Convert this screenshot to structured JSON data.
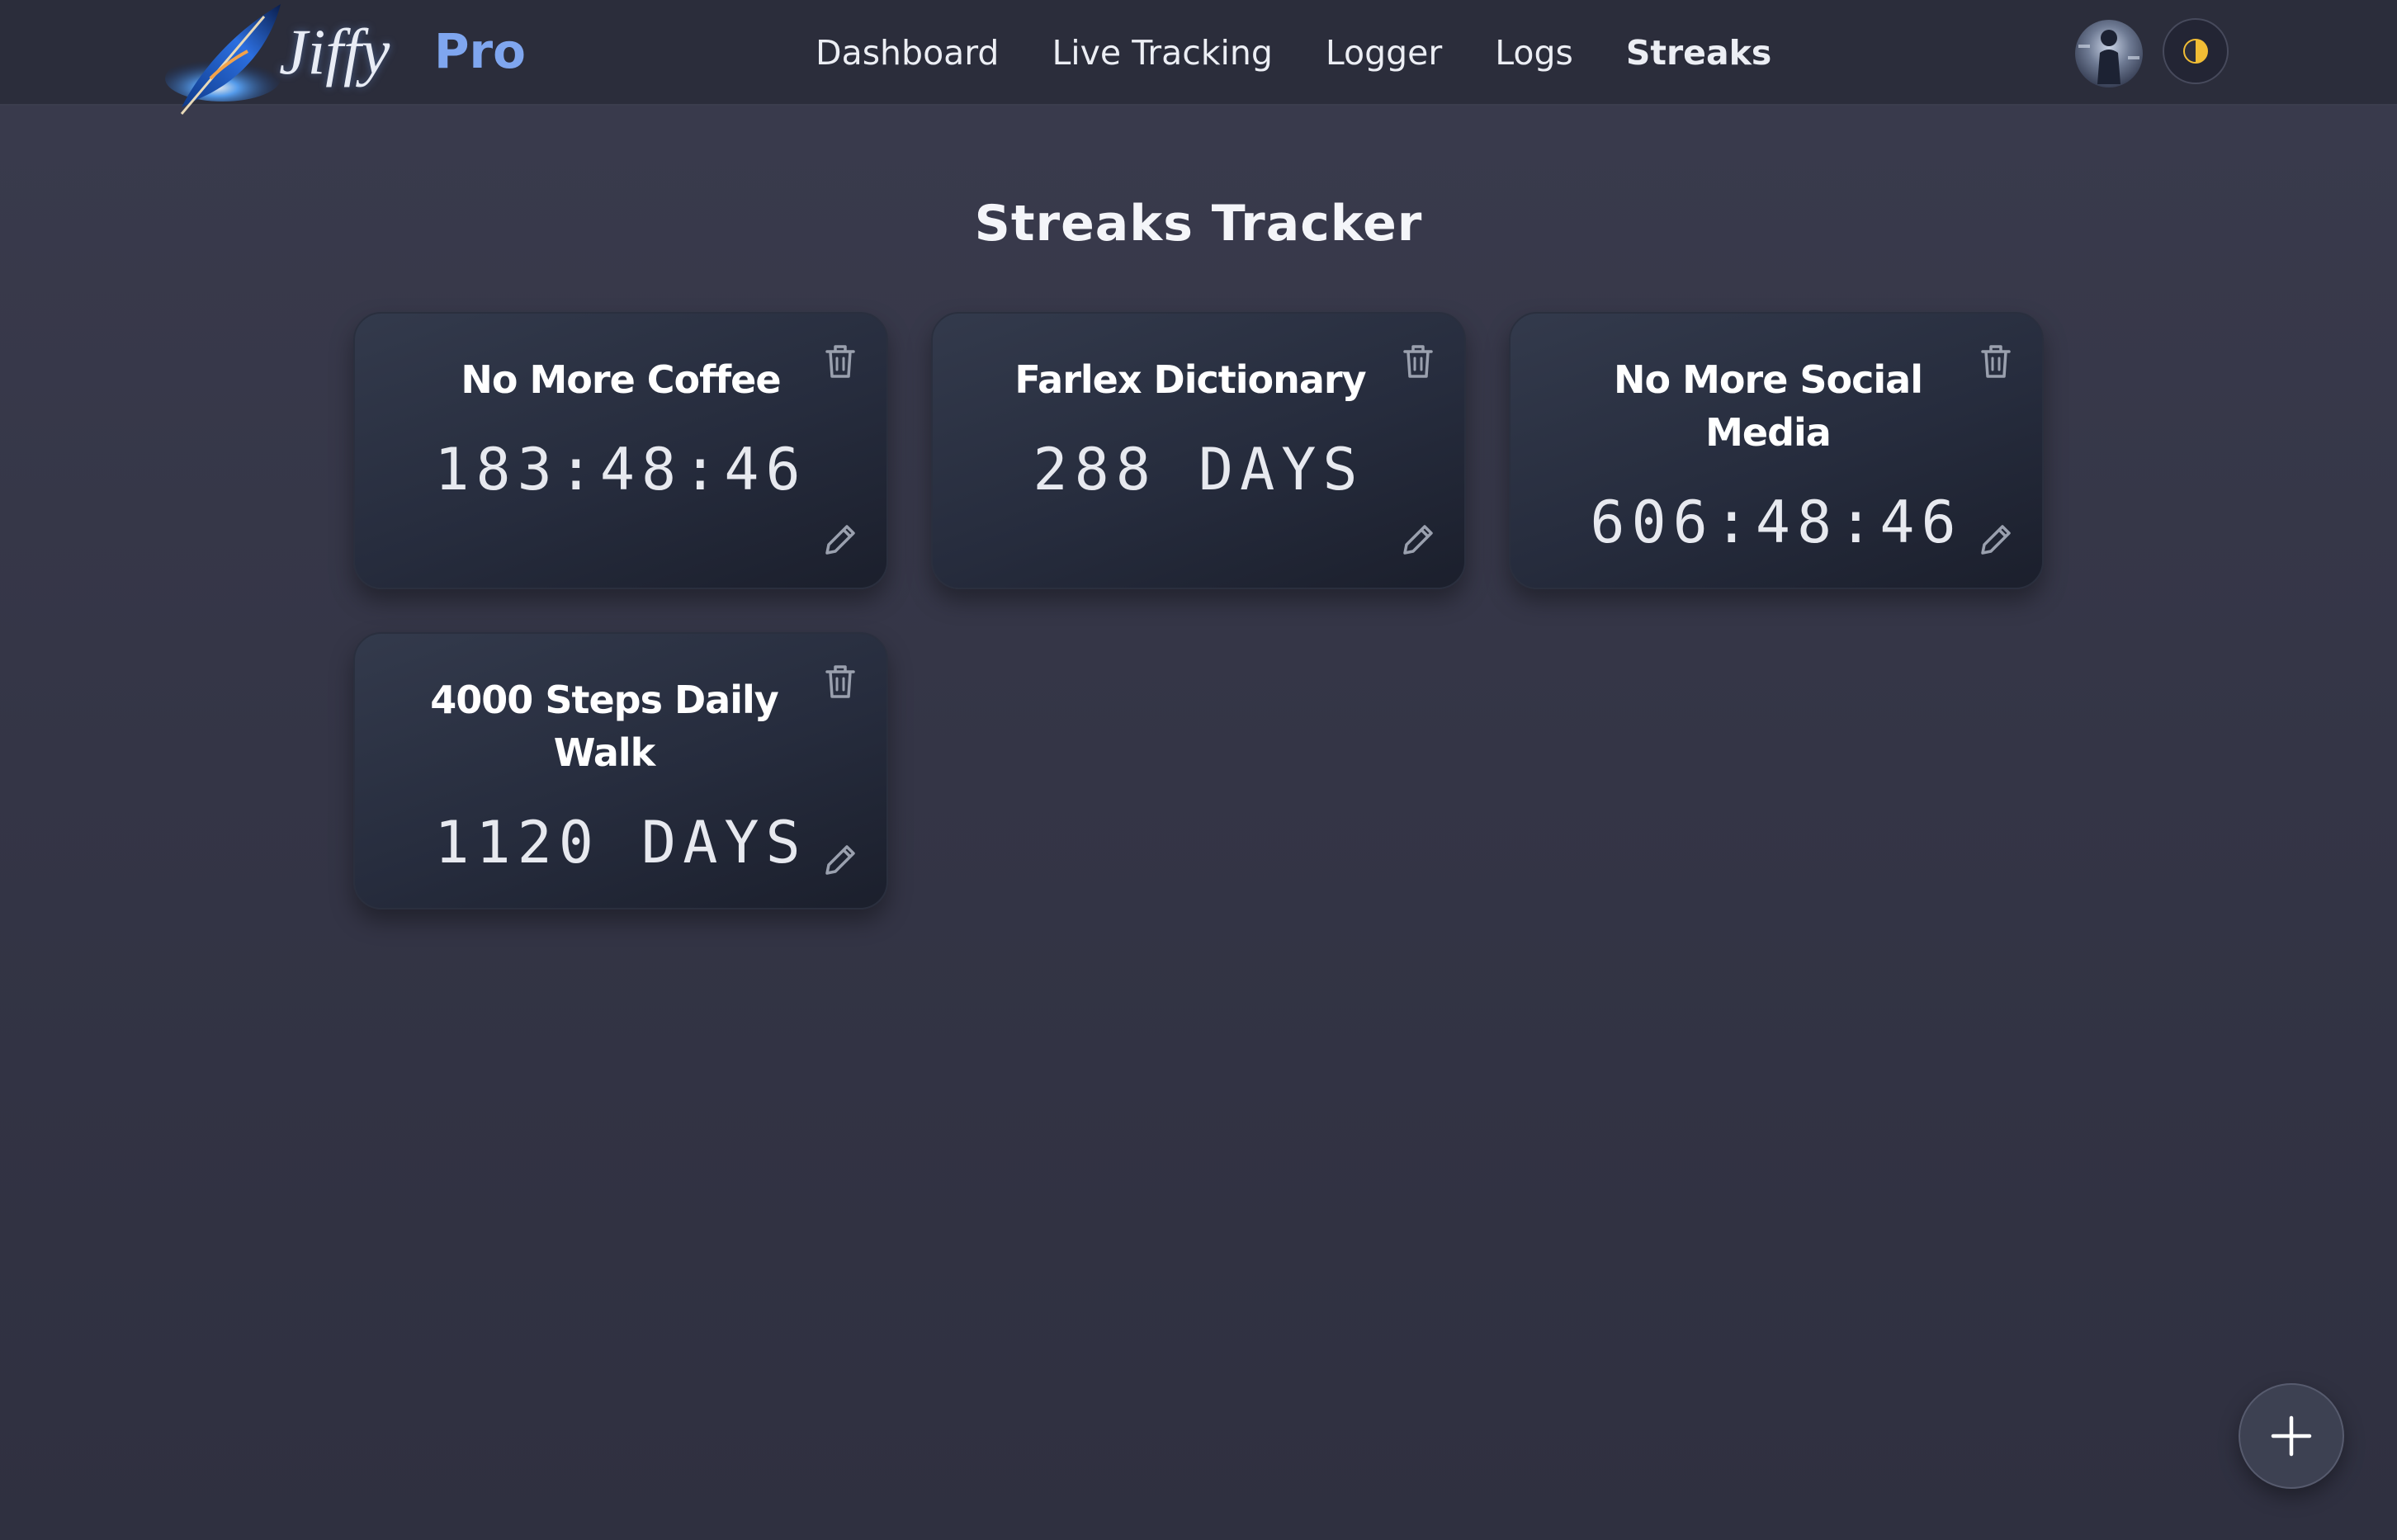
{
  "brand": {
    "name": "Jiffy",
    "tier": "Pro"
  },
  "nav": {
    "links": [
      {
        "label": "Dashboard",
        "active": false
      },
      {
        "label": "Live Tracking",
        "active": false
      },
      {
        "label": "Logger",
        "active": false
      },
      {
        "label": "Logs",
        "active": false
      },
      {
        "label": "Streaks",
        "active": true
      }
    ]
  },
  "header": {
    "avatar_icon": "user-avatar",
    "theme_icon": "half-moon-icon"
  },
  "page": {
    "title": "Streaks Tracker"
  },
  "streaks": [
    {
      "title": "No More Coffee",
      "value": "183:48:46"
    },
    {
      "title": "Farlex Dictionary",
      "value": "288 DAYS"
    },
    {
      "title": "No More Social Media",
      "value": "606:48:46"
    },
    {
      "title": "4000 Steps Daily Walk",
      "value": "1120 DAYS"
    }
  ],
  "icons": {
    "delete": "trash-icon",
    "edit": "pencil-icon",
    "add": "plus-icon"
  },
  "colors": {
    "accent": "#7fa6ef",
    "card": "#262c3d",
    "background": "#343546"
  }
}
